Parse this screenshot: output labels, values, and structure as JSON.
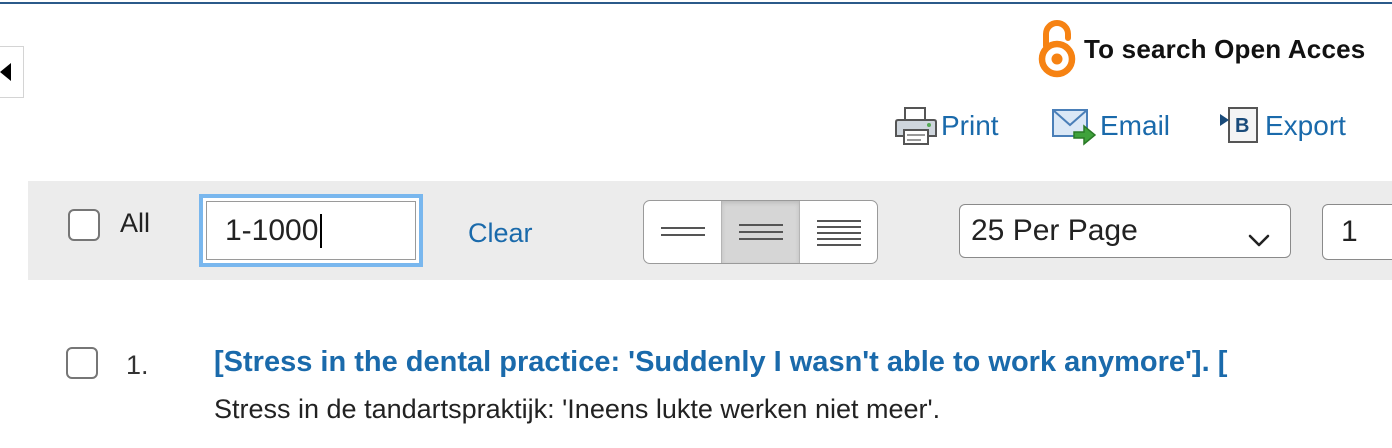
{
  "open_access": {
    "text": "To search Open Acces",
    "icon": "open-access-lock-icon",
    "accent": "#f68212"
  },
  "actions": {
    "print_label": "Print",
    "email_label": "Email",
    "export_label": "Export"
  },
  "toolbar": {
    "all_label": "All",
    "range_value": "1-1000",
    "clear_label": "Clear",
    "density_options": [
      "compact-view",
      "standard-view",
      "detailed-view"
    ],
    "density_selected": "standard-view",
    "per_page": "25 Per Page",
    "page_number": "1"
  },
  "results": [
    {
      "number": "1.",
      "title": "[Stress in the dental practice: 'Suddenly I wasn't able to work anymore']. [",
      "subtitle": "Stress in de tandartspraktijk: 'Ineens lukte werken niet meer'."
    }
  ],
  "colors": {
    "link": "#1a6aab",
    "toolbar_bg": "#ececec",
    "focus_ring": "#79b7ee",
    "top_rule": "#2b5a8a"
  }
}
